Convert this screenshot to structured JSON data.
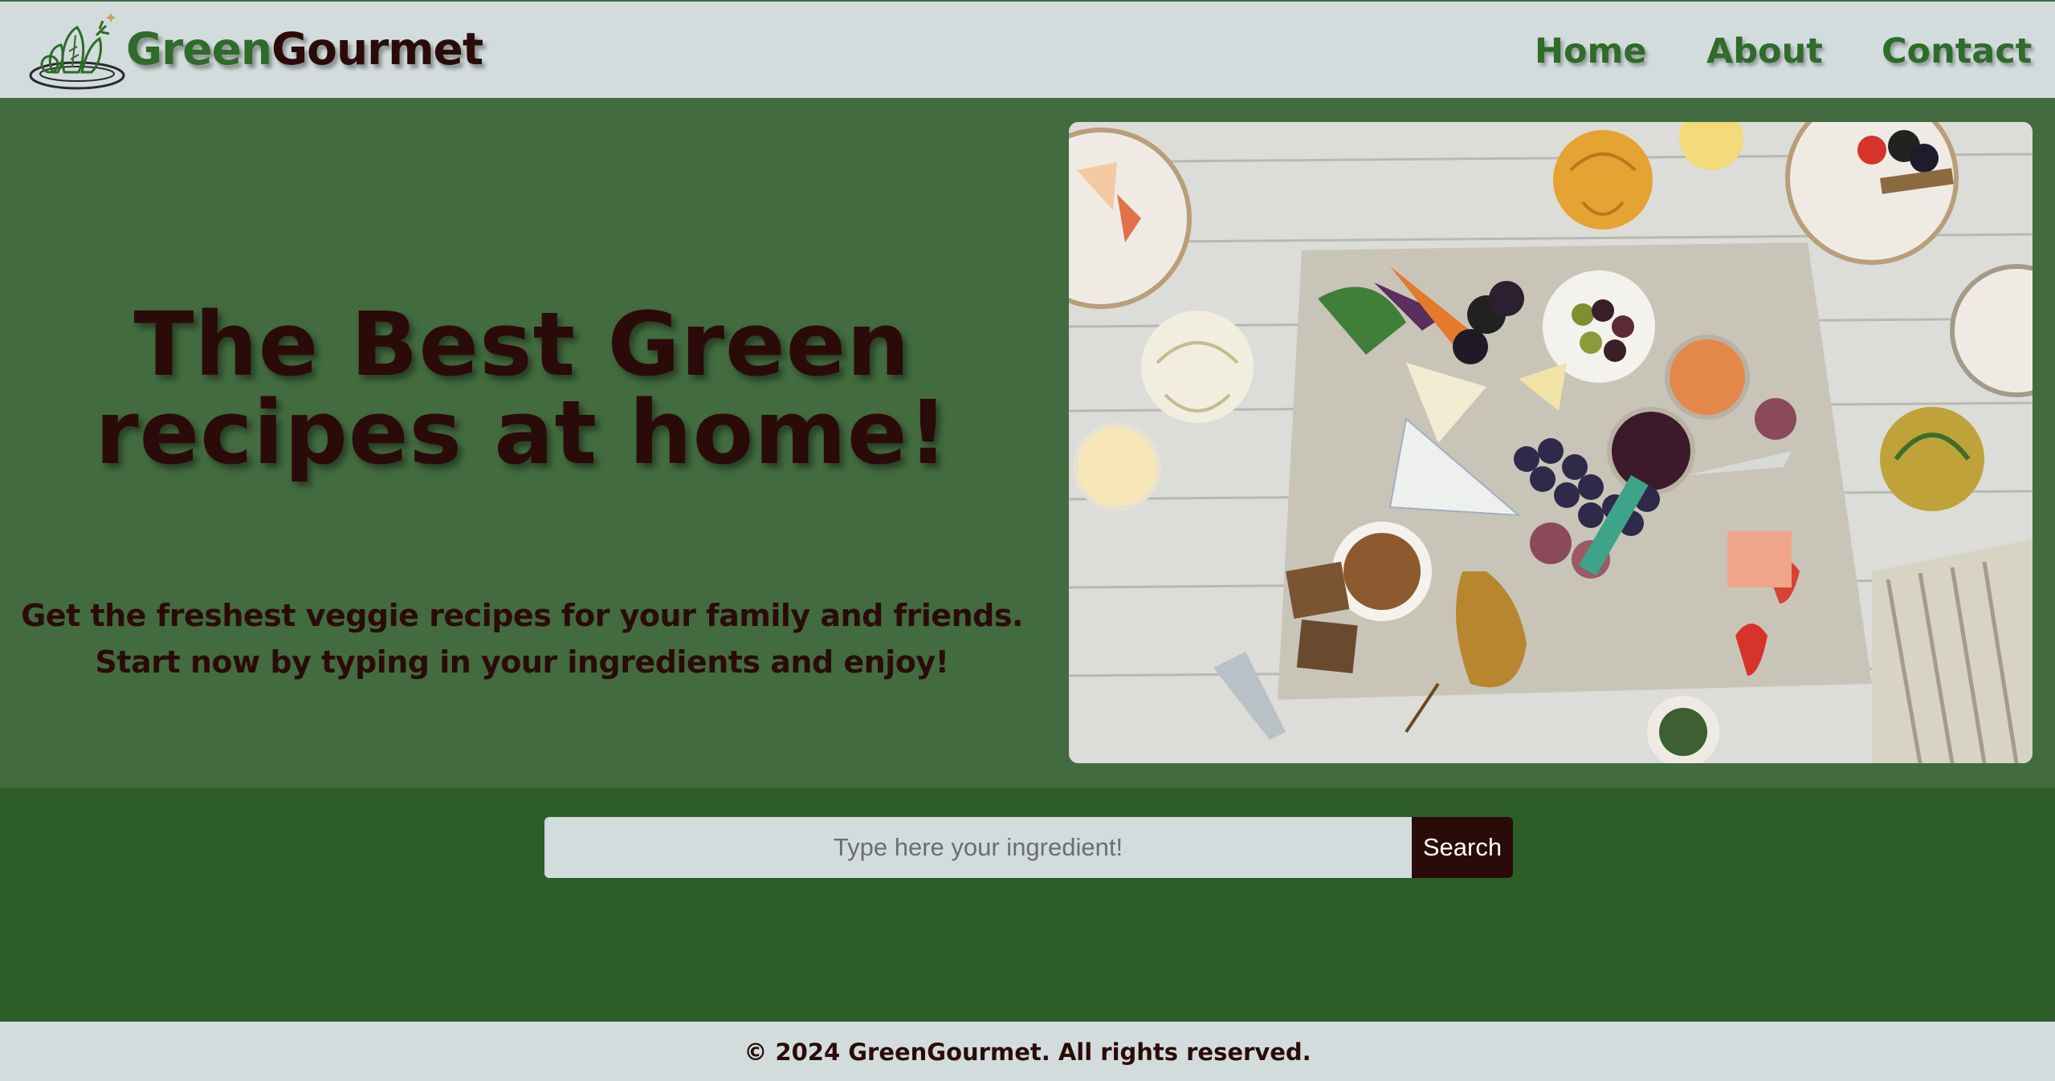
{
  "header": {
    "brand_part1": "Green",
    "brand_part2": "Gourmet",
    "logo_icon": "veggie-plate-icon",
    "nav": [
      {
        "label": "Home"
      },
      {
        "label": "About"
      },
      {
        "label": "Contact"
      }
    ]
  },
  "hero": {
    "title_line1": "The Best Green",
    "title_line2": "recipes at home!",
    "subtitle_line1": "Get the freshest veggie recipes for your family and friends.",
    "subtitle_line2": "Start now by typing in your ingredients and enjoy!",
    "image_icon": "food-platter-photo"
  },
  "search": {
    "placeholder": "Type here your ingredient!",
    "value": "",
    "button_label": "Search"
  },
  "footer": {
    "text": "© 2024 GreenGourmet. All rights reserved."
  },
  "colors": {
    "header_bg": "#d2dcdc",
    "hero_bg": "#426b3f",
    "search_band_bg": "#2d5e2a",
    "brand_green": "#2f6b29",
    "dark_text": "#2b0b09"
  }
}
